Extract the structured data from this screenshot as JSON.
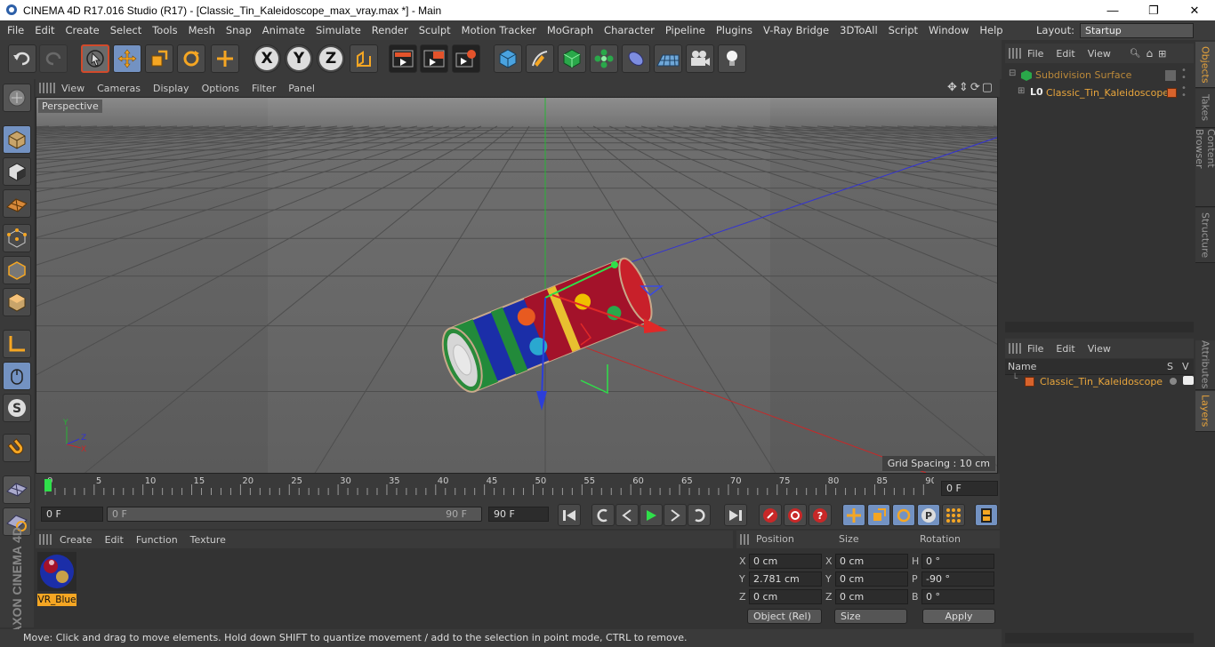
{
  "window": {
    "title": "CINEMA 4D R17.016 Studio (R17) - [Classic_Tin_Kaleidoscope_max_vray.max *] - Main",
    "minimize": "—",
    "maximize": "❐",
    "close": "✕"
  },
  "menu": [
    "File",
    "Edit",
    "Create",
    "Select",
    "Tools",
    "Mesh",
    "Snap",
    "Animate",
    "Simulate",
    "Render",
    "Sculpt",
    "Motion Tracker",
    "MoGraph",
    "Character",
    "Pipeline",
    "Plugins",
    "V-Ray Bridge",
    "3DToAll",
    "Script",
    "Window",
    "Help"
  ],
  "layout": {
    "label": "Layout:",
    "value": "Startup"
  },
  "toolbar": {
    "axis_x": "X",
    "axis_y": "Y",
    "axis_z": "Z",
    "icons": [
      "undo-icon",
      "redo-icon",
      "select-icon",
      "move-icon",
      "scale-icon",
      "rotate-icon",
      "last-tool-icon",
      "axis-x-icon",
      "axis-y-icon",
      "axis-z-icon",
      "coordinate-system-icon",
      "render-view-icon",
      "render-picture-viewer-icon",
      "render-settings-icon",
      "cube-icon",
      "pen-icon",
      "subdivision-icon",
      "cloner-icon",
      "deformer-icon",
      "floor-icon",
      "camera-icon",
      "light-icon"
    ]
  },
  "viewport": {
    "menu": [
      "View",
      "Cameras",
      "Display",
      "Options",
      "Filter",
      "Panel"
    ],
    "camera_label": "Perspective",
    "grid_spacing": "Grid Spacing : 10 cm",
    "axis_y": "Y",
    "axis_x": "X",
    "axis_z": "Z"
  },
  "timeline": {
    "ticks": [
      "0",
      "5",
      "10",
      "15",
      "20",
      "25",
      "30",
      "35",
      "40",
      "45",
      "50",
      "55",
      "60",
      "65",
      "70",
      "75",
      "80",
      "85",
      "90"
    ],
    "current_frame": "0 F",
    "start_frame": "0 F",
    "range_start": "0 F",
    "range_end": "90 F",
    "end_frame": "90 F"
  },
  "material_manager": {
    "menu": [
      "Create",
      "Edit",
      "Function",
      "Texture"
    ],
    "materials": [
      {
        "name": "VR_Blue"
      }
    ]
  },
  "coordinates": {
    "headers": {
      "position": "Position",
      "size": "Size",
      "rotation": "Rotation"
    },
    "rows": [
      {
        "axis": "X",
        "pos": "0 cm",
        "size_axis": "X",
        "size": "0 cm",
        "rot_axis": "H",
        "rot": "0 °"
      },
      {
        "axis": "Y",
        "pos": "2.781 cm",
        "size_axis": "Y",
        "size": "0 cm",
        "rot_axis": "P",
        "rot": "-90 °"
      },
      {
        "axis": "Z",
        "pos": "0 cm",
        "size_axis": "Z",
        "size": "0 cm",
        "rot_axis": "B",
        "rot": "0 °"
      }
    ],
    "mode": "Object (Rel)",
    "size_mode": "Size",
    "apply": "Apply"
  },
  "object_manager": {
    "menu": [
      "File",
      "Edit",
      "View"
    ],
    "objects": [
      {
        "name": "Subdivision Surface"
      },
      {
        "name": "Classic_Tin_Kaleidoscope"
      }
    ]
  },
  "layer_manager": {
    "menu": [
      "File",
      "Edit",
      "View"
    ],
    "col_name": "Name",
    "col_s": "S",
    "col_v": "V",
    "layers": [
      {
        "name": "Classic_Tin_Kaleidoscope",
        "color": "#d8632c"
      }
    ]
  },
  "side_tabs": {
    "top": [
      "Objects",
      "Takes",
      "Content Browser",
      "Structure"
    ],
    "bottom": [
      "Attributes",
      "Layers"
    ]
  },
  "brand": "MAXON CINEMA 4D",
  "status": "Move: Click and drag to move elements. Hold down SHIFT to quantize movement / add to the selection in point mode, CTRL to remove."
}
